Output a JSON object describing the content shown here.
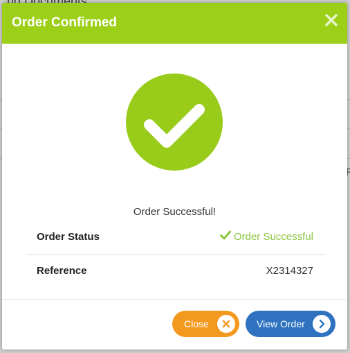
{
  "background": {
    "heading_fragment": "nd Documents",
    "side_fragment_right": "R"
  },
  "modal": {
    "title": "Order Confirmed",
    "close_icon": "close-x-icon",
    "success_icon": "check-circle-icon",
    "message": "Order Successful!",
    "rows": [
      {
        "label": "Order Status",
        "value": "Order Successful",
        "value_icon": "check-icon"
      },
      {
        "label": "Reference",
        "value": "X2314327"
      }
    ],
    "buttons": {
      "close_label": "Close",
      "close_icon": "close-circle-icon",
      "view_label": "View Order",
      "view_icon": "chevron-right-icon"
    }
  },
  "colors": {
    "header": "#9ccf17",
    "success_circle": "#99cc1a",
    "status_text": "#8cc63f",
    "close_button": "#f39a1e",
    "view_button": "#2e72c0"
  }
}
